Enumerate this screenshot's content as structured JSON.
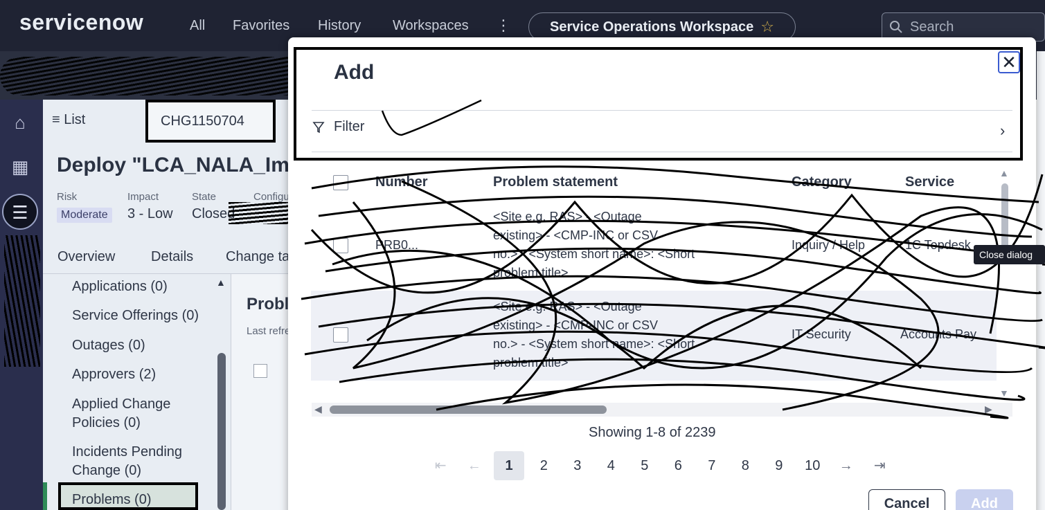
{
  "topnav": {
    "logo": "servicenow",
    "items": [
      "All",
      "Favorites",
      "History",
      "Workspaces"
    ],
    "more": "⋮",
    "workspace_title": "Service Operations Workspace",
    "search_placeholder": "Search"
  },
  "record": {
    "list_label": "List",
    "tab_label": "CHG1150704",
    "title": "Deploy \"LCA_NALA_Imp",
    "meta": [
      {
        "label": "Risk",
        "value": "Moderate"
      },
      {
        "label": "Impact",
        "value": "3 - Low"
      },
      {
        "label": "State",
        "value": "Closed"
      },
      {
        "label": "Configu",
        "value": ""
      }
    ],
    "tabs": [
      "Overview",
      "Details",
      "Change ta"
    ]
  },
  "related": {
    "items": [
      "Applications (0)",
      "Service Offerings (0)",
      "Outages (0)",
      "Approvers (2)",
      "Applied Change Policies (0)",
      "Incidents Pending Change (0)",
      "Problems (0)"
    ]
  },
  "midpanel": {
    "title": "Probl",
    "subtitle": "Last refre"
  },
  "modal": {
    "title": "Add",
    "close_label": "✕",
    "close_tooltip": "Close dialog",
    "filter_label": "Filter",
    "columns": [
      "Number",
      "Problem statement",
      "Category",
      "Service"
    ],
    "rows": [
      {
        "number": "PRB0...",
        "statement": [
          "<Site e.g. RAS> - <Outage",
          "existing> - <CMP-INC or CSV",
          "no.> - <System short name>: <Short",
          "problem title>"
        ],
        "category": "Inquiry / Help",
        "service": "1C Topdesk"
      },
      {
        "number": "",
        "statement": [
          "<Site e.g. RAS> - <Outage",
          "existing> - <CMP-INC or CSV",
          "no.> - <System short name>: <Short",
          "problem title>"
        ],
        "category": "IT Security",
        "service": "Accounts Pay"
      }
    ],
    "showing": "Showing 1-8 of 2239",
    "pages": [
      "1",
      "2",
      "3",
      "4",
      "5",
      "6",
      "7",
      "8",
      "9",
      "10"
    ],
    "current_page": "1",
    "cancel_label": "Cancel",
    "add_label": "Add"
  }
}
